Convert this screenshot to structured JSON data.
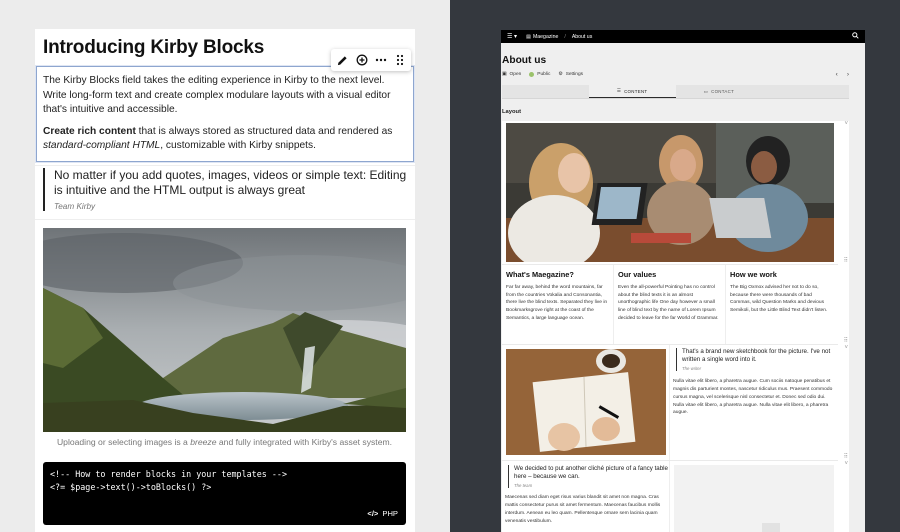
{
  "editor": {
    "title": "Introducing Kirby Blocks",
    "toolbar": [
      "pencil-icon",
      "plus-circle-icon",
      "more-icon",
      "drag-handle-icon"
    ],
    "text": {
      "paragraph1": "The Kirby Blocks field takes the editing experience in Kirby to the next level. Write long-form text and create complex modulare layouts with a visual editor that's intuitive and accessible.",
      "p2_bold": "Create rich content",
      "p2_rest": " that is always stored as structured data and rendered as ",
      "p2_italic": "standard-compliant HTML",
      "p2_end": ", customizable with Kirby snippets."
    },
    "quote": {
      "text": "No matter if you add quotes, images, videos or simple text: Editing is intuitive and the HTML output is always great",
      "citation": "Team Kirby"
    },
    "image": {
      "caption_start": "Uploading or selecting images is a ",
      "caption_em": "breeze",
      "caption_end": " and fully integrated with Kirby's asset system."
    },
    "code": {
      "line1": "<!-- How to render blocks in your templates -->",
      "line2": "<?= $page->text()->toBlocks() ?>",
      "language": "PHP"
    }
  },
  "panel": {
    "topbar": {
      "site": "Maegazine",
      "page": "About us"
    },
    "page_title": "About us",
    "actions": {
      "open": "Open",
      "status": "Public",
      "settings": "Settings"
    },
    "tabs": [
      "CONTENT",
      "CONTACT"
    ],
    "layout_label": "Layout",
    "columns": [
      {
        "heading": "What's Maegazine?",
        "text": "Far far away, behind the word mountains, far from the countries Vokalia and Consonantia, there live the blind texts. Separated they live in Bookmarksgrove right at the coast of the Semantics, a large language ocean."
      },
      {
        "heading": "Our values",
        "text": "Even the all-powerful Pointing has no control about the blind texts it is an almost unorthographic life One day however a small line of blind text by the name of Lorem Ipsum decided to leave for the far World of Grammar."
      },
      {
        "heading": "How we work",
        "text": "The Big Oxmox advised her not to do so, because there were thousands of bad Commas, wild Question Marks and devious Semikoli, but the Little Blind Text didn't listen."
      }
    ],
    "sketch": {
      "quote": "That's a brand new sketchbook for the picture. I've not written a single word into it.",
      "cite": "The writer",
      "text": "Nulla vitae elit libero, a pharetra augue. Cum sociis natoque penatibus et magnis dis parturient montes, nascetur ridiculus mus. Praesent commodo cursus magna, vel scelerisque nisl consectetur et. Donec sed odio dui. Nulla vitae elit libero, a pharetra augue. Nulla vitae elit libero, a pharetra augue."
    },
    "cliche": {
      "quote": "We decided to put another cliché picture of a fancy table here – because we can.",
      "cite": "The team",
      "text": "Maecenas sed diam eget risus varius blandit sit amet non magna. Cras mattis consectetur purus sit amet fermentum. Maecenas faucibus mollis interdum. Aenean eu leo quam. Pellentesque ornare sem lacinia quam venenatis vestibulum."
    }
  }
}
